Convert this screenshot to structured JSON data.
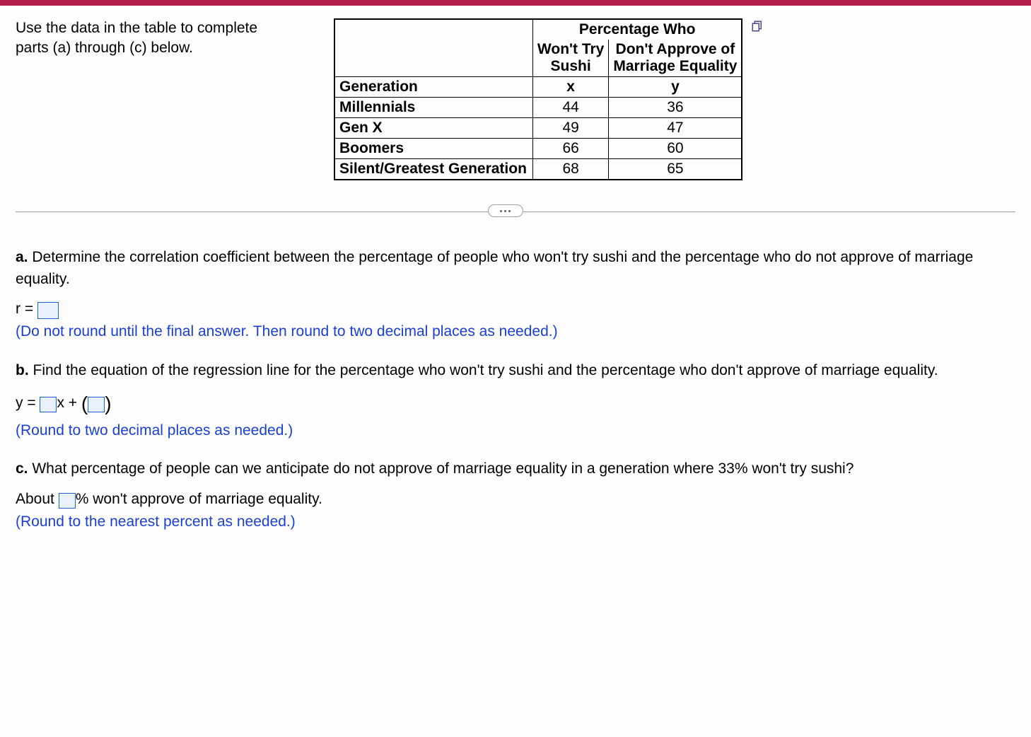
{
  "prompt": "Use the data in the table to complete parts (a) through (c) below.",
  "table": {
    "header_spanning": "Percentage Who",
    "col1_top": "Won't Try",
    "col1_bot": "Sushi",
    "col2_top": "Don't Approve of",
    "col2_bot": "Marriage Equality",
    "rowhead": "Generation",
    "xvar": "x",
    "yvar": "y",
    "rows": [
      {
        "label": "Millennials",
        "x": "44",
        "y": "36"
      },
      {
        "label": "Gen X",
        "x": "49",
        "y": "47"
      },
      {
        "label": "Boomers",
        "x": "66",
        "y": "60"
      },
      {
        "label": "Silent/Greatest Generation",
        "x": "68",
        "y": "65"
      }
    ]
  },
  "parts": {
    "a": {
      "label": "a.",
      "text": " Determine the correlation coefficient between the percentage of people who won't try sushi and the percentage who do not approve of marriage equality.",
      "eq_lhs": "r =",
      "hint": "(Do not round until the final answer. Then round to two decimal places as needed.)"
    },
    "b": {
      "label": "b.",
      "text": " Find the equation of the regression line for the percentage who won't try sushi and the percentage who don't approve of marriage equality.",
      "eq_lhs": "y =",
      "eq_mid": "x +",
      "hint": "(Round to two decimal places as needed.)"
    },
    "c": {
      "label": "c.",
      "text": " What percentage of people can we anticipate do not approve of marriage equality in a generation where 33% won't try sushi?",
      "pre": "About",
      "post": "% won't approve of marriage equality.",
      "hint": "(Round to the nearest percent as needed.)"
    }
  },
  "chart_data": {
    "type": "table",
    "title": "Percentage Who Won't Try Sushi vs Don't Approve of Marriage Equality",
    "columns": [
      "Generation",
      "Won't Try Sushi (x)",
      "Don't Approve of Marriage Equality (y)"
    ],
    "rows": [
      [
        "Millennials",
        44,
        36
      ],
      [
        "Gen X",
        49,
        47
      ],
      [
        "Boomers",
        66,
        60
      ],
      [
        "Silent/Greatest Generation",
        68,
        65
      ]
    ]
  }
}
